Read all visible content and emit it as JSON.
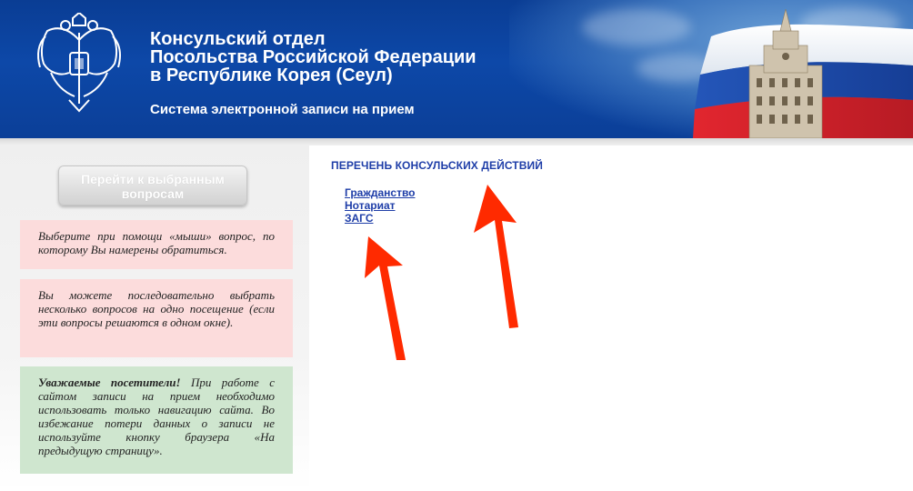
{
  "header": {
    "title_lines": [
      "Консульский отдел",
      "Посольства Российской Федерации",
      "в Республике Корея (Сеул)"
    ],
    "subtitle": "Система электронной записи на прием",
    "colors": {
      "header_blue": "#0d48a8",
      "flag_white": "#ffffff",
      "flag_blue": "#1d4fb5",
      "flag_red": "#d8242d"
    }
  },
  "sidebar": {
    "goto_button_label": "Перейти к выбранным вопросам",
    "note1": "Выберите при помощи «мыши» вопрос, по которому Вы намерены обратиться.",
    "note2": "Вы можете последовательно выбрать несколько вопросов на одно посещение (если эти вопросы решаются в одном окне).",
    "note3_bold": "Уважаемые посетители!",
    "note3_text": " При работе с сайтом записи на прием необходимо использовать только навигацию сайта. Во избежание потери данных о записи не используйте кнопку браузера «На предыдущую страницу».",
    "colors": {
      "pink": "#fcdcdc",
      "green": "#cfe6cf"
    }
  },
  "main": {
    "title": "ПЕРЕЧЕНЬ КОНСУЛЬСКИХ ДЕЙСТВИЙ",
    "links": [
      "Гражданство",
      "Нотариат",
      "ЗАГС"
    ],
    "link_color": "#1f3ea8",
    "annotation_arrow_color": "#ff2a00"
  }
}
